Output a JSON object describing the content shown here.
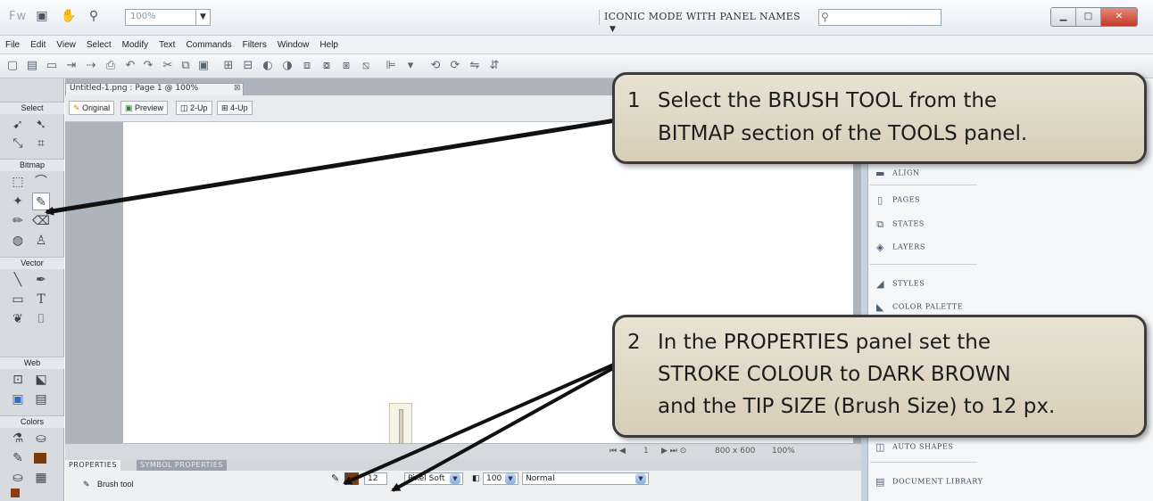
{
  "app": {
    "logo": "Fw",
    "zoom_value": "100%",
    "workspace_mode": "ICONIC MODE WITH PANEL NAMES",
    "search_placeholder": ""
  },
  "menu": [
    "File",
    "Edit",
    "View",
    "Select",
    "Modify",
    "Text",
    "Commands",
    "Filters",
    "Window",
    "Help"
  ],
  "document": {
    "tab_title": "Untitled-1.png : Page 1 @ 100%",
    "view_buttons": [
      "Original",
      "Preview",
      "2-Up",
      "4-Up"
    ],
    "status": {
      "page_num": "1",
      "canvas_size": "800 x 600",
      "zoom": "100%"
    }
  },
  "tools": {
    "sections": [
      "Select",
      "Bitmap",
      "Vector",
      "Web",
      "Colors"
    ],
    "stroke_color": "#7a3a0c",
    "fill_color": "#8a3b12"
  },
  "properties": {
    "tabs": [
      "PROPERTIES",
      "SYMBOL PROPERTIES"
    ],
    "tool_name": "Brush tool",
    "stroke_color": "#7a3a0c",
    "tip_size": "12",
    "edge": "Pixel Soft",
    "opacity": "100",
    "blend": "Normal"
  },
  "right_panel": {
    "items": [
      "ALIGN",
      "PAGES",
      "STATES",
      "LAYERS",
      "STYLES",
      "COLOR PALETTE",
      "AUTO SHAPES",
      "DOCUMENT LIBRARY"
    ]
  },
  "callouts": {
    "c1": {
      "num": "1",
      "line1": "Select the BRUSH TOOL from the",
      "line2": "BITMAP section of the TOOLS panel."
    },
    "c2": {
      "num": "2",
      "line1": "In the PROPERTIES panel set the",
      "line2": "STROKE COLOUR to DARK BROWN",
      "line3": "and the TIP SIZE (Brush Size) to 12 px."
    }
  }
}
